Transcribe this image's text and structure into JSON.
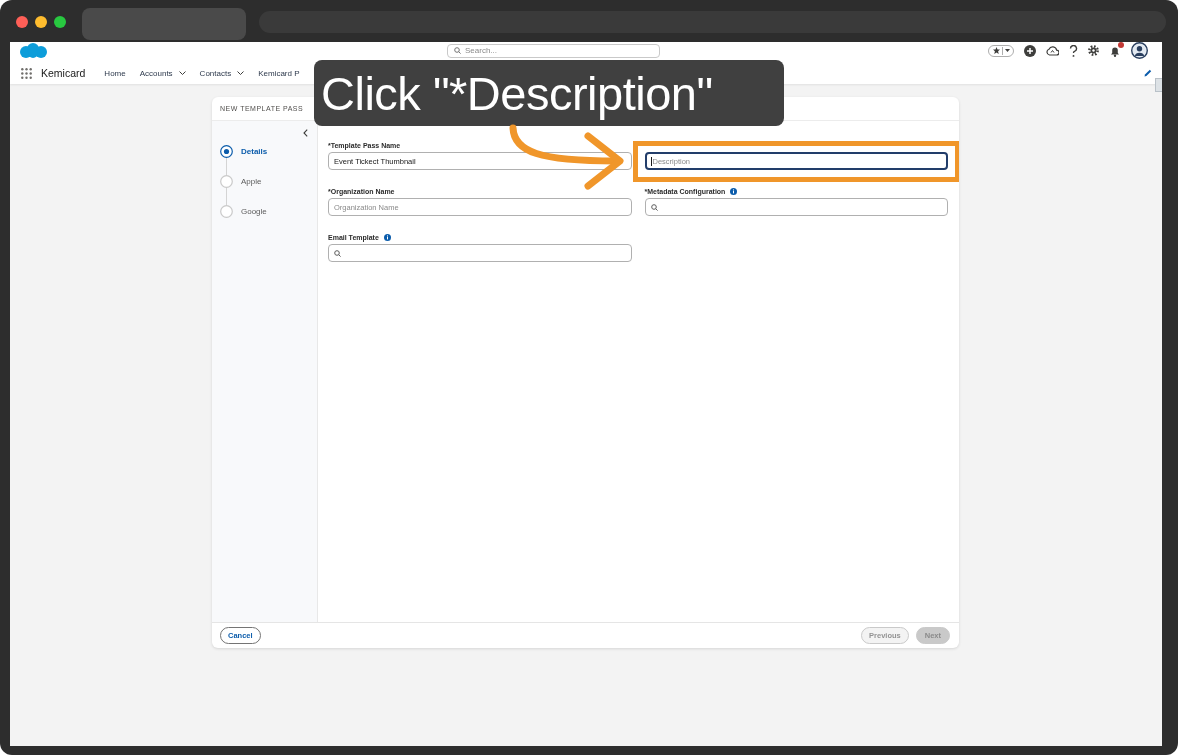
{
  "app_header": {
    "search": {
      "placeholder": "Search..."
    },
    "notifications": {
      "unread": true
    },
    "app_name": "Kemicard",
    "nav_items": [
      {
        "label": "Home",
        "has_menu": false
      },
      {
        "label": "Accounts",
        "has_menu": true
      },
      {
        "label": "Contacts",
        "has_menu": true
      },
      {
        "label": "Kemicard P",
        "has_menu": false
      }
    ]
  },
  "modal": {
    "title": "NEW TEMPLATE PASS",
    "steps": [
      {
        "label": "Details",
        "selected": true
      },
      {
        "label": "Apple",
        "selected": false
      },
      {
        "label": "Google",
        "selected": false
      }
    ],
    "fields": [
      {
        "kind": "text",
        "label": "*Template Pass Name",
        "info": false,
        "value": "Event Tickect Thumbnail",
        "focused": false,
        "highlighted": false
      },
      {
        "kind": "text",
        "placeholder": "Description",
        "info": false,
        "focused": true,
        "highlighted": true
      },
      {
        "kind": "text",
        "label": "*Organization Name",
        "info": false,
        "placeholder": "Organization Name",
        "focused": false,
        "highlighted": false
      },
      {
        "kind": "lookup",
        "label": "*Metadata Configuration",
        "info": true,
        "focused": false,
        "highlighted": false
      },
      {
        "kind": "lookup",
        "label": "Email Template",
        "info": true,
        "focused": false,
        "highlighted": false
      }
    ],
    "footer": {
      "start_buttons": [
        {
          "label": "Cancel",
          "kind": "neutral",
          "disabled": false
        }
      ],
      "end_buttons": [
        {
          "label": "Previous",
          "kind": "neutral",
          "disabled": true
        },
        {
          "label": "Next",
          "kind": "brand",
          "disabled": true
        }
      ]
    }
  },
  "annotation": {
    "text": "Click \"*Description\""
  }
}
